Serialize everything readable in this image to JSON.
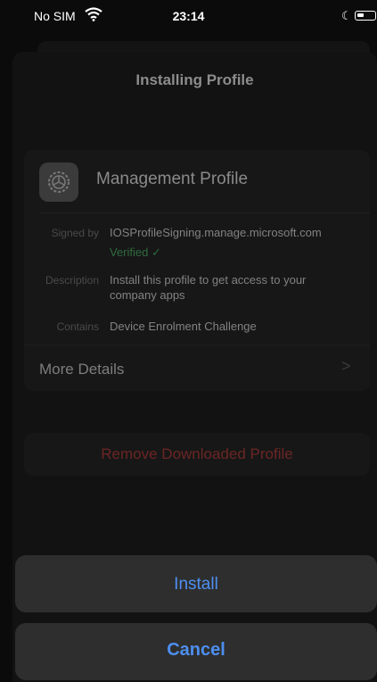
{
  "status_bar": {
    "carrier": "No SIM",
    "time": "23:14"
  },
  "nav": {
    "title": "Installing Profile"
  },
  "profile": {
    "name": "Management Profile",
    "icon": "gear-icon",
    "rows": [
      {
        "label": "Signed by",
        "value": "IOSProfileSigning.manage.microsoft.com"
      },
      {
        "label": "Description",
        "value": "Install this profile to get access to your company apps"
      },
      {
        "label": "Contains",
        "value": "Device Enrolment Challenge"
      }
    ],
    "verified": "Verified ✓",
    "more_details": "More Details"
  },
  "remove_button": "Remove Downloaded Profile",
  "actions": {
    "install": "Install",
    "cancel": "Cancel"
  },
  "colors": {
    "accent": "#4d8ff0",
    "destructive": "#6b2624",
    "verified": "#2f6a3d"
  }
}
